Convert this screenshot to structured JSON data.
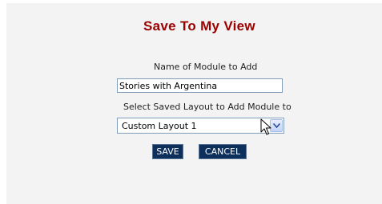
{
  "dialog": {
    "title": "Save To My View"
  },
  "module_name": {
    "label": "Name of Module to Add",
    "value": "Stories with Argentina"
  },
  "layout_select": {
    "label": "Select Saved Layout to Add Module to",
    "selected": "Custom Layout 1"
  },
  "buttons": {
    "save": "SAVE",
    "cancel": "CANCEL"
  },
  "icons": {
    "dropdown": "chevron-down-icon",
    "cursor": "mouse-pointer-icon"
  },
  "colors": {
    "title": "#990000",
    "button_bg": "#0d2f5b",
    "button_text": "#ffffff",
    "panel_bg": "#f3f3f3",
    "input_border": "#7f9db9"
  }
}
